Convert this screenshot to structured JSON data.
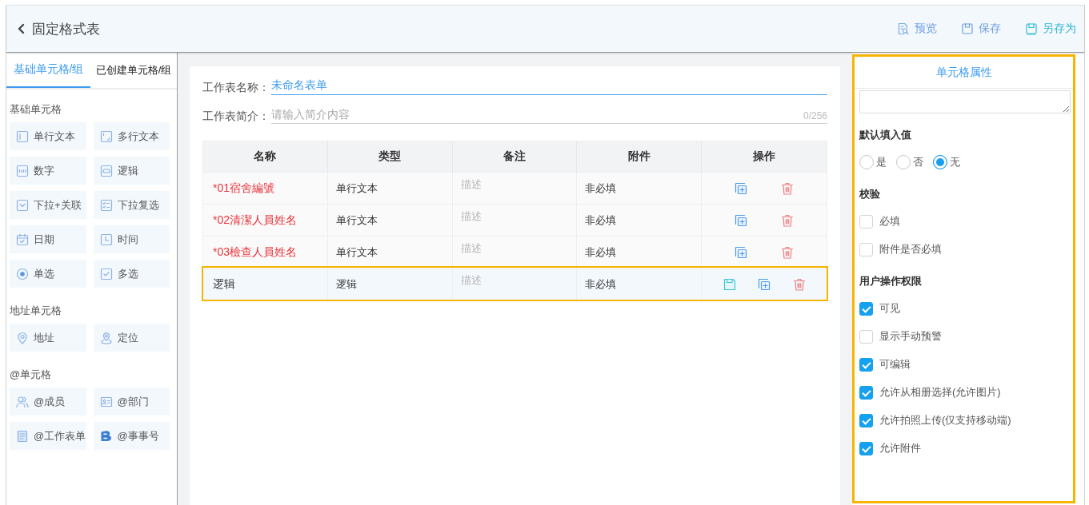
{
  "header": {
    "title": "固定格式表",
    "actions": [
      {
        "kind": "preview",
        "label": "预览"
      },
      {
        "kind": "save",
        "label": "保存"
      },
      {
        "kind": "save_as",
        "label": "另存为"
      }
    ]
  },
  "sidebar": {
    "tabs": [
      {
        "label": "基础单元格/组",
        "selected": true
      },
      {
        "label": "已创建单元格/组",
        "selected": false
      }
    ],
    "groups": [
      {
        "title": "基础单元格",
        "items": [
          {
            "kind": "single_line",
            "label": "单行文本"
          },
          {
            "kind": "multi_line",
            "label": "多行文本"
          },
          {
            "kind": "number",
            "label": "数字"
          },
          {
            "kind": "logic",
            "label": "逻辑"
          },
          {
            "kind": "dropdown",
            "label": "下拉+关联"
          },
          {
            "kind": "multi_dropdown",
            "label": "下拉复选"
          },
          {
            "kind": "date",
            "label": "日期"
          },
          {
            "kind": "time",
            "label": "时间"
          },
          {
            "kind": "radio",
            "label": "单选"
          },
          {
            "kind": "checkbox",
            "label": "多选"
          }
        ]
      },
      {
        "title": "地址单元格",
        "items": [
          {
            "kind": "address",
            "label": "地址"
          },
          {
            "kind": "location",
            "label": "定位"
          }
        ]
      },
      {
        "title": "@单元格",
        "items": [
          {
            "kind": "member",
            "label": "@成员"
          },
          {
            "kind": "department",
            "label": "@部门"
          },
          {
            "kind": "worksheet",
            "label": "@工作表单"
          },
          {
            "kind": "event",
            "label": "@事事号"
          }
        ]
      }
    ]
  },
  "form": {
    "name": {
      "label": "工作表名称：",
      "value": "未命名表单"
    },
    "intro": {
      "label": "工作表简介：",
      "placeholder": "请输入简介内容",
      "counter": "0/256"
    }
  },
  "table": {
    "columns": [
      "名称",
      "类型",
      "备注",
      "附件",
      "操作"
    ],
    "rows": [
      {
        "name": "*01宿舍編號",
        "required": true,
        "type": "单行文本",
        "note": {
          "placeholder": "描述"
        },
        "attachment": "非必填",
        "selected": false,
        "actions": [
          {
            "kind": "duplicate"
          },
          {
            "kind": "delete"
          }
        ]
      },
      {
        "name": "*02清潔人員姓名",
        "required": true,
        "type": "单行文本",
        "note": {
          "placeholder": "描述"
        },
        "attachment": "非必填",
        "selected": false,
        "actions": [
          {
            "kind": "duplicate"
          },
          {
            "kind": "delete"
          }
        ]
      },
      {
        "name": "*03檢查人員姓名",
        "required": true,
        "type": "单行文本",
        "note": {
          "placeholder": "描述"
        },
        "attachment": "非必填",
        "selected": false,
        "actions": [
          {
            "kind": "duplicate"
          },
          {
            "kind": "delete"
          }
        ]
      },
      {
        "name": "逻辑",
        "required": false,
        "type": "逻辑",
        "note": {
          "placeholder": "描述"
        },
        "attachment": "非必填",
        "selected": true,
        "actions": [
          {
            "kind": "save"
          },
          {
            "kind": "duplicate"
          },
          {
            "kind": "delete"
          }
        ]
      }
    ]
  },
  "properties": {
    "title": "单元格属性",
    "sections": [
      {
        "title": "默认填入值",
        "kind": "radio",
        "options": [
          {
            "label": "是",
            "selected": false
          },
          {
            "label": "否",
            "selected": false
          },
          {
            "label": "无",
            "selected": true
          }
        ]
      },
      {
        "title": "校验",
        "kind": "checkbox",
        "options": [
          {
            "label": "必填",
            "checked": false
          },
          {
            "label": "附件是否必填",
            "checked": false
          }
        ]
      },
      {
        "title": "用户操作权限",
        "kind": "checkbox",
        "options": [
          {
            "label": "可见",
            "checked": true
          },
          {
            "label": "显示手动预警",
            "checked": false
          },
          {
            "label": "可编辑",
            "checked": true
          },
          {
            "label": "允许从相册选择(允许图片)",
            "checked": true
          },
          {
            "label": "允许拍照上传(仅支持移动端)",
            "checked": true
          },
          {
            "label": "允许附件",
            "checked": true
          }
        ]
      }
    ]
  }
}
